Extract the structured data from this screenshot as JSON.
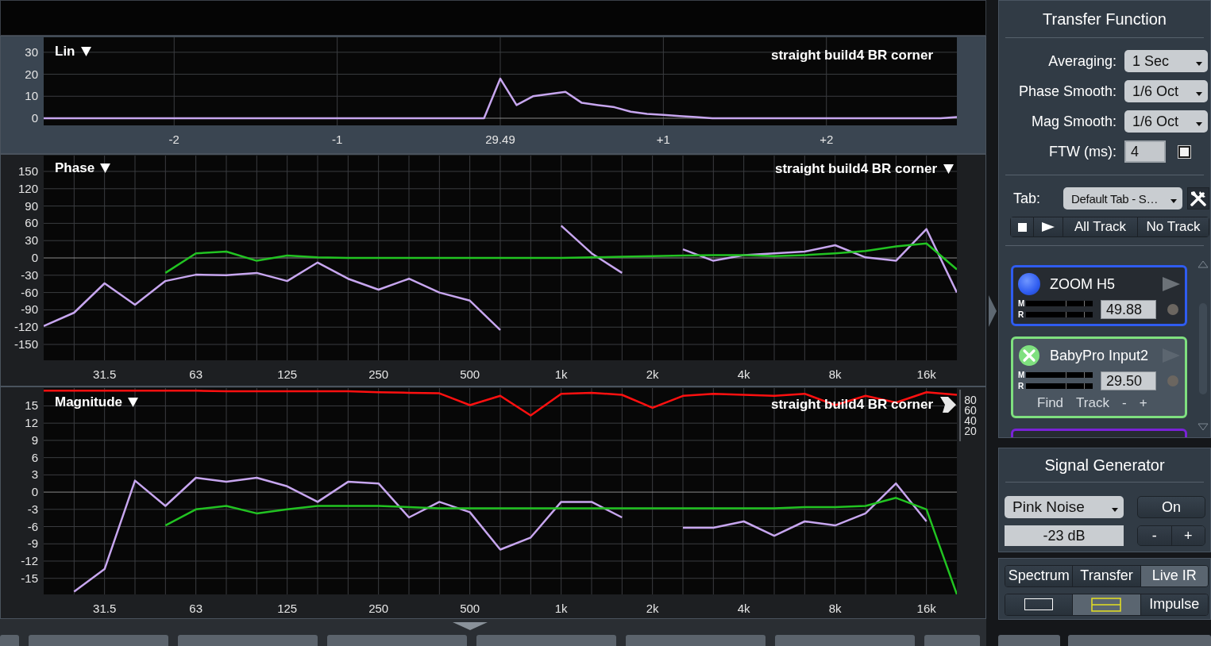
{
  "lin_plot": {
    "selected": true,
    "scale_menu": "Lin",
    "trace_name": "straight build4 BR corner",
    "chart_data": {
      "type": "line",
      "grid": true,
      "categories": [
        null,
        null,
        null,
        null,
        null,
        null,
        null,
        null,
        "-2",
        null,
        null,
        null,
        null,
        null,
        null,
        null,
        null,
        null,
        "-1",
        null,
        null,
        null,
        null,
        null,
        null,
        null,
        null,
        null,
        "29.49",
        null,
        null,
        null,
        null,
        null,
        null,
        null,
        null,
        null,
        "+1",
        null,
        null,
        null,
        null,
        null,
        null,
        null,
        null,
        null,
        "+2",
        null,
        null,
        null,
        null,
        null,
        null,
        null,
        null
      ],
      "ylim": [
        -3.25,
        36.8
      ],
      "yticks": [
        0,
        10,
        20,
        30
      ],
      "series": [
        {
          "color": "#c7a6ef",
          "values": [
            0,
            0,
            0,
            0,
            0,
            0,
            0,
            0,
            0,
            0,
            0,
            0,
            0,
            0,
            0,
            0,
            0,
            0,
            0,
            0,
            0,
            0,
            0,
            0,
            0,
            0,
            0,
            0,
            18,
            6,
            10,
            11,
            12,
            7,
            6,
            5,
            3,
            2,
            1.5,
            1,
            0.5,
            0,
            0,
            0,
            0,
            0,
            0,
            0,
            0,
            0,
            0,
            0,
            0,
            0,
            0,
            0,
            0.5
          ]
        }
      ]
    }
  },
  "phase_plot": {
    "selected": false,
    "scale_menu": "Phase",
    "trace_name": "straight build4 BR corner",
    "trace_control": {
      "kind": "caret"
    },
    "chart_data": {
      "type": "line",
      "grid": true,
      "categories": [
        null,
        null,
        "31.5",
        null,
        null,
        "63",
        null,
        null,
        "125",
        null,
        null,
        "250",
        null,
        null,
        "500",
        null,
        null,
        "1k",
        null,
        null,
        "2k",
        null,
        null,
        "4k",
        null,
        null,
        "8k",
        null,
        null,
        "16k",
        null
      ],
      "ylim": [
        -177.5,
        177.5
      ],
      "yticks": [
        -150,
        -120,
        -90,
        -60,
        -30,
        0,
        30,
        60,
        90,
        120,
        150
      ],
      "series": [
        {
          "color": "#c7a6ef",
          "values": [
            -118,
            -95,
            -44,
            -81,
            -40,
            -29,
            -30,
            -26,
            -40,
            -8,
            -36,
            -55,
            -36,
            -60,
            -74,
            -125,
            null,
            56,
            8,
            -26,
            null,
            15,
            -5,
            5,
            8,
            11,
            22,
            1,
            -5,
            50,
            -60
          ]
        },
        {
          "color": "#22c322",
          "values": [
            null,
            null,
            null,
            null,
            -26,
            8,
            11,
            -5,
            4,
            1,
            0,
            0,
            0,
            0,
            0,
            0,
            0,
            0,
            1,
            2,
            3,
            4,
            5,
            5,
            3,
            5,
            8,
            12,
            20,
            25,
            -20
          ]
        }
      ]
    }
  },
  "magnitude_plot": {
    "selected": false,
    "scale_menu": "Magnitude",
    "trace_name": "straight build4 BR corner",
    "trace_control": {
      "kind": "play"
    },
    "chart_data": {
      "type": "line",
      "grid": true,
      "categories": [
        null,
        null,
        "31.5",
        null,
        null,
        "63",
        null,
        null,
        "125",
        null,
        null,
        "250",
        null,
        null,
        "500",
        null,
        null,
        "1k",
        null,
        null,
        "2k",
        null,
        null,
        "4k",
        null,
        null,
        "8k",
        null,
        null,
        "16k",
        null
      ],
      "ylim": [
        -17.8,
        18.1
      ],
      "yticks": [
        -15,
        -12,
        -9,
        -6,
        -3,
        0,
        3,
        6,
        9,
        12,
        15
      ],
      "series": [
        {
          "color": "#c7a6ef",
          "values": [
            null,
            -17.3,
            -13.4,
            2,
            -2.4,
            2.5,
            1.8,
            2.5,
            1,
            -1.7,
            1.8,
            1.5,
            -4.4,
            -1.7,
            -3.5,
            -10,
            -7.9,
            -1.7,
            -1.7,
            -4.4,
            null,
            -6.2,
            -6.2,
            -5.1,
            -7.6,
            -5.1,
            -5.8,
            -3.7,
            1.5,
            -5.1,
            null
          ]
        },
        {
          "color": "#22c322",
          "values": [
            null,
            null,
            null,
            null,
            -5.8,
            -3,
            -2.4,
            -3.7,
            -3,
            -2.4,
            -2.4,
            -2.4,
            -2.6,
            -2.8,
            -2.8,
            -2.8,
            -2.8,
            -2.8,
            -2.8,
            -2.8,
            -2.8,
            -2.8,
            -2.8,
            -2.8,
            -2.8,
            -2.6,
            -2.6,
            -2.4,
            -1,
            -3,
            -17.8
          ]
        }
      ]
    },
    "coherence": {
      "chart_data": {
        "type": "line",
        "ylim": [
          0,
          100
        ],
        "categories": [
          null,
          null,
          null,
          null,
          null,
          null,
          null,
          null,
          null,
          null,
          null,
          null,
          null,
          null,
          null,
          null,
          null,
          null,
          null,
          null,
          null,
          null,
          null,
          null,
          null,
          null,
          null,
          null,
          null,
          null,
          null
        ],
        "yticks": [
          20,
          40,
          60,
          80
        ],
        "series": [
          {
            "color": "#ff1010",
            "values": [
              98,
              98,
              98,
              98,
              98,
              98,
              97,
              97,
              97,
              97,
              97,
              95,
              94,
              93,
              70,
              88,
              50,
              92,
              94,
              90,
              65,
              88,
              92,
              90,
              88,
              92,
              70,
              88,
              75,
              95,
              90
            ]
          }
        ]
      }
    }
  },
  "transfer_function": {
    "title": "Transfer Function",
    "settings": [
      {
        "kind": "dropdown",
        "label": "Averaging:",
        "value": "1 Sec"
      },
      {
        "kind": "dropdown",
        "label": "Phase Smooth:",
        "value": "1/6 Oct"
      },
      {
        "kind": "dropdown",
        "label": "Mag Smooth:",
        "value": "1/6 Oct"
      },
      {
        "kind": "field",
        "label": "FTW (ms):",
        "value": "4",
        "checked": false
      }
    ]
  },
  "tab_selector": {
    "label": "Tab:",
    "value": "Default Tab - S…"
  },
  "track_buttons": [
    "All Track",
    "No Track"
  ],
  "measurements": [
    {
      "kind": "dot",
      "name": "ZOOM H5",
      "color": "#2f5cf0",
      "selected": false,
      "meter_labels": [
        "M",
        "R"
      ],
      "value": "49.88"
    },
    {
      "kind": "x",
      "name": "BabyPro Input2",
      "color": "#7fe07f",
      "selected": true,
      "meter_labels": [
        "M",
        "R"
      ],
      "value": "29.50",
      "actions": [
        "Find",
        "Track",
        "-",
        "+"
      ]
    },
    {
      "color": "#7a22d8",
      "selected": false
    }
  ],
  "signal_generator": {
    "title": "Signal Generator",
    "signal": "Pink Noise",
    "level": "-23 dB",
    "on_button": "On",
    "level_buttons": [
      "-",
      "+"
    ]
  },
  "modes": [
    {
      "label": "Spectrum",
      "selected": false
    },
    {
      "label": "Transfer",
      "selected": false
    },
    {
      "label": "Live IR",
      "selected": true
    }
  ],
  "layouts": [
    {
      "kind": "single",
      "selected": false
    },
    {
      "kind": "split",
      "selected": true
    },
    {
      "kind": "text",
      "label": "Impulse",
      "selected": false
    }
  ]
}
